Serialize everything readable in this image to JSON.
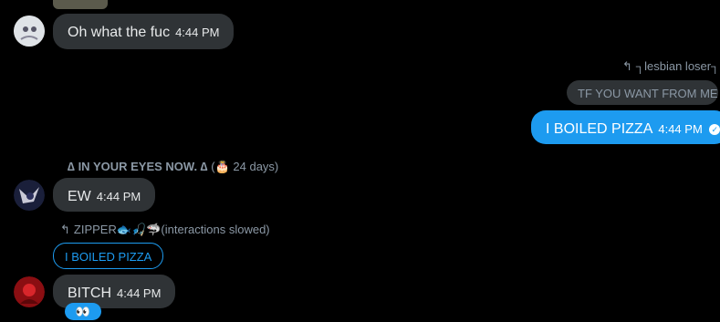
{
  "messages": [
    {
      "sender_avatar": "avatar-1",
      "text": "Oh what the fuc",
      "time": "4:44 PM"
    },
    {
      "reply_to_user": "┐lesbian loser┐",
      "quoted_text": "TF YOU WANT FROM ME",
      "text": "I BOILED PIZZA",
      "time": "4:44 PM",
      "own": true
    },
    {
      "sender_name": "∆ IN YOUR EYES NOW. ∆",
      "sender_badge": "(🎂 24 days)",
      "text": "EW",
      "time": "4:44 PM"
    },
    {
      "reply_to_user": "ZIPPER🐟🎣🦈(interactions slowed)",
      "quoted_text": "I BOILED PIZZA",
      "text": "BITCH",
      "time": "4:44 PM",
      "reaction": "👀"
    }
  ],
  "colors": {
    "own_bubble": "#1d9bf0",
    "other_bubble": "#2f3336",
    "background": "#000000"
  }
}
